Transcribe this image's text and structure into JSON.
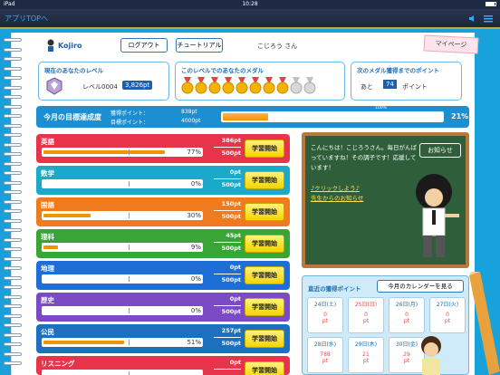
{
  "status_bar": {
    "carrier": "iPad",
    "time": "10:28"
  },
  "nav": {
    "back_label": "アプリTOPへ"
  },
  "header": {
    "logo_text": "Kojiro",
    "logout_label": "ログアウト",
    "tutorial_label": "チュートリアル",
    "username": "こじろう さん",
    "mypage_label": "マイページ"
  },
  "level_panel": {
    "title": "現在のあなたのレベル",
    "level": "レベル0004",
    "points": "3,826pt"
  },
  "medal_panel": {
    "title": "このレベルでのあなたのメダル",
    "earned": 8,
    "total": 10
  },
  "next_panel": {
    "title": "次のメダル獲得までのポイント",
    "prefix": "あと",
    "value": "74",
    "suffix": "ポイント"
  },
  "goal": {
    "title": "今月の目標達成度",
    "acquired_label": "獲得ポイント：",
    "acquired_value": "838pt",
    "target_label": "目標ポイント：",
    "target_value": "4000pt",
    "hundred_label": "100%",
    "percent": "21%",
    "fraction": 0.21
  },
  "subjects": [
    {
      "name": "英語",
      "percent": "77%",
      "fraction": 0.77,
      "points": "386pt",
      "goal": "500pt",
      "button": "学習開始",
      "color": "#e8344a"
    },
    {
      "name": "数学",
      "percent": "0%",
      "fraction": 0.0,
      "points": "0pt",
      "goal": "500pt",
      "button": "学習開始",
      "color": "#1aa9c9"
    },
    {
      "name": "国語",
      "percent": "30%",
      "fraction": 0.3,
      "points": "150pt",
      "goal": "500pt",
      "button": "学習開始",
      "color": "#f07a1e"
    },
    {
      "name": "理科",
      "percent": "9%",
      "fraction": 0.09,
      "points": "45pt",
      "goal": "500pt",
      "button": "学習開始",
      "color": "#3aa537"
    },
    {
      "name": "地理",
      "percent": "0%",
      "fraction": 0.0,
      "points": "0pt",
      "goal": "500pt",
      "button": "学習開始",
      "color": "#1e6ed8"
    },
    {
      "name": "歴史",
      "percent": "0%",
      "fraction": 0.0,
      "points": "0pt",
      "goal": "500pt",
      "button": "学習開始",
      "color": "#7a4bc4"
    },
    {
      "name": "公民",
      "percent": "51%",
      "fraction": 0.51,
      "points": "257pt",
      "goal": "500pt",
      "button": "学習開始",
      "color": "#1d6fc0"
    },
    {
      "name": "リスニング",
      "percent": "",
      "fraction": 0.0,
      "points": "0pt",
      "goal": "",
      "button": "学習開始",
      "color": "#e8344a"
    }
  ],
  "chalkboard": {
    "greeting": "こんにちは！こじろうさん。毎日がんばっていますね！その調子です！応援しています！",
    "notice_label": "お知らせ",
    "click_label": "♪クリックしよう♪",
    "teacher_link": "先生からのお知らせ"
  },
  "calendar": {
    "title": "直近の獲得ポイント",
    "button_label": "今月のカレンダーを見る",
    "days": [
      {
        "date": "24日(土)",
        "value": "0",
        "unit": "pt"
      },
      {
        "date": "25日(日)",
        "value": "0",
        "unit": "pt"
      },
      {
        "date": "26日(月)",
        "value": "0",
        "unit": "pt"
      },
      {
        "date": "27日(火)",
        "value": "0",
        "unit": "pt"
      },
      {
        "date": "28日(水)",
        "value": "788",
        "unit": "pt"
      },
      {
        "date": "29日(木)",
        "value": "21",
        "unit": "pt"
      },
      {
        "date": "30日(金)",
        "value": "29",
        "unit": "pt"
      }
    ]
  }
}
